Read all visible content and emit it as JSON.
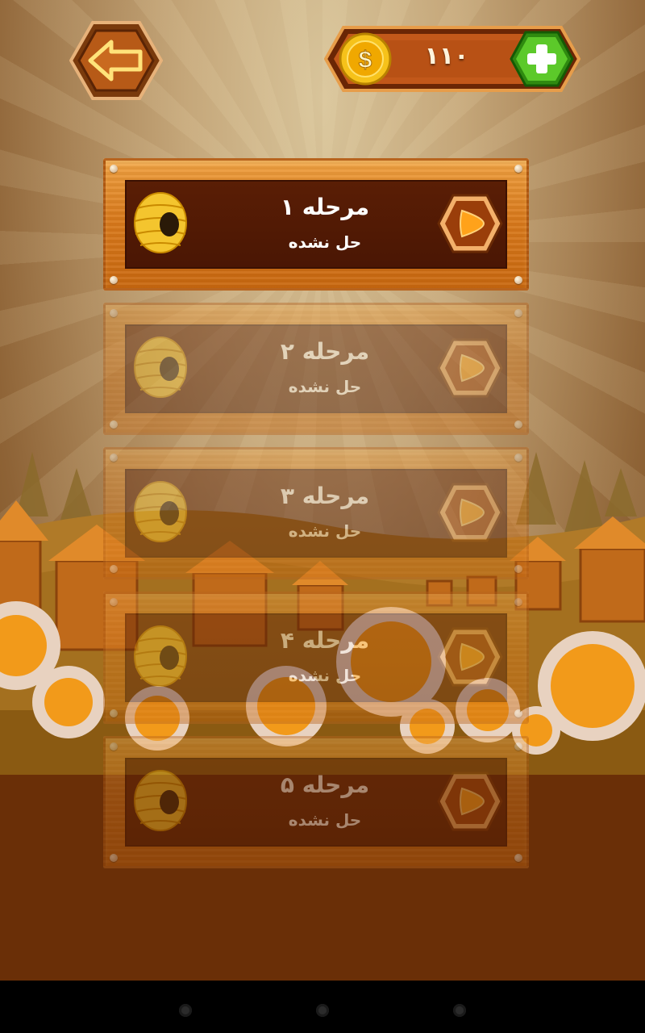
{
  "topbar": {
    "back_icon": "back-arrow-icon",
    "coin_icon": "dollar-coin-icon",
    "coins": "۱۱۰",
    "add_icon": "plus-icon"
  },
  "levels": [
    {
      "title": "مرحله ۱",
      "status": "حل نشده",
      "locked": false,
      "icon": "beehive-icon"
    },
    {
      "title": "مرحله ۲",
      "status": "حل نشده",
      "locked": true,
      "icon": "beehive-icon"
    },
    {
      "title": "مرحله ۳",
      "status": "حل نشده",
      "locked": true,
      "icon": "beehive-icon"
    },
    {
      "title": "مرحله ۴",
      "status": "حل نشده",
      "locked": true,
      "icon": "beehive-icon"
    },
    {
      "title": "مرحله ۵",
      "status": "حل نشده",
      "locked": true,
      "icon": "beehive-icon"
    }
  ],
  "navbar": {
    "buttons": [
      "back-nav-icon",
      "home-nav-icon",
      "recents-nav-icon"
    ]
  },
  "colors": {
    "wood": "#d97a1c",
    "panel": "#4a1604",
    "green_button": "#3fae1e",
    "coin_gold": "#f5c518"
  }
}
